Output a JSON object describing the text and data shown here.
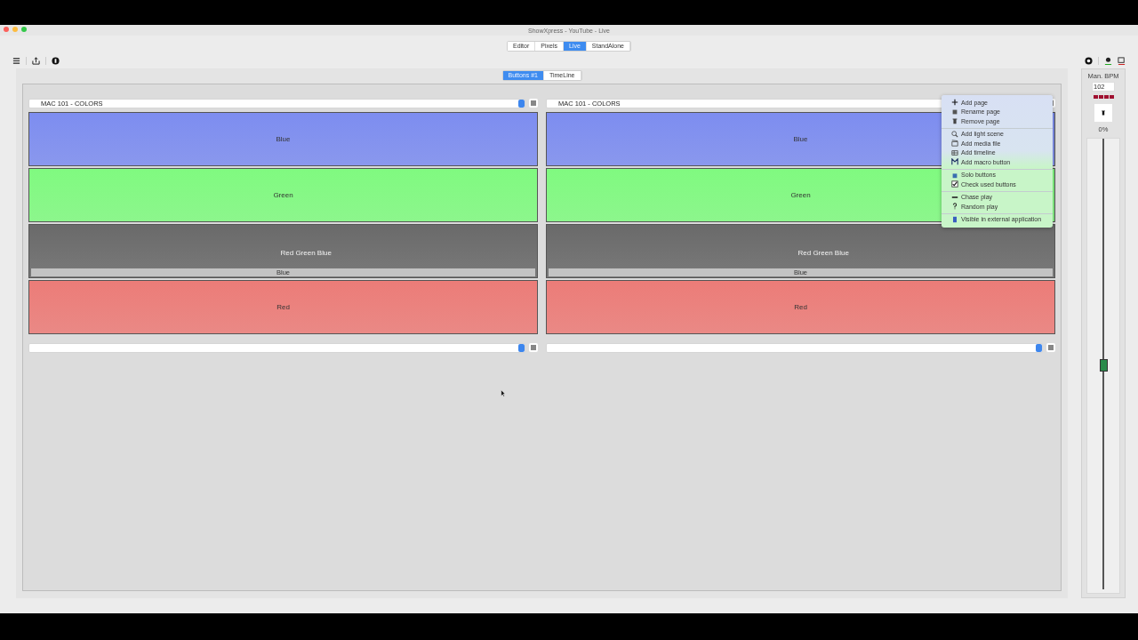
{
  "window": {
    "title": "ShowXpress - YouTube - Live"
  },
  "mode_tabs": [
    {
      "label": "Editor",
      "selected": false
    },
    {
      "label": "Pixels",
      "selected": false
    },
    {
      "label": "Live",
      "selected": true
    },
    {
      "label": "StandAlone",
      "selected": false
    }
  ],
  "view_tabs": [
    {
      "label": "Buttons #1",
      "selected": true
    },
    {
      "label": "TimeLine",
      "selected": false
    }
  ],
  "columns": [
    {
      "page": "MAC 101 - COLORS",
      "buttons": [
        {
          "label": "Blue",
          "color": "#7d8df0"
        },
        {
          "label": "Green",
          "color": "#80fa80"
        },
        {
          "label": "Red Green Blue",
          "color": "#6a6a6a",
          "sub_label": "Blue"
        },
        {
          "label": "Red",
          "color": "#ec7c78"
        }
      ]
    },
    {
      "page": "MAC 101 - COLORS",
      "buttons": [
        {
          "label": "Blue",
          "color": "#7d8df0"
        },
        {
          "label": "Green",
          "color": "#80fa80"
        },
        {
          "label": "Red Green Blue",
          "color": "#6a6a6a",
          "sub_label": "Blue"
        },
        {
          "label": "Red",
          "color": "#ec7c78"
        }
      ]
    }
  ],
  "context_menu": {
    "sections": [
      {
        "items": [
          {
            "label": "Add page",
            "kind": "plus"
          },
          {
            "label": "Rename page",
            "kind": "rename"
          },
          {
            "label": "Remove page",
            "kind": "trash"
          }
        ]
      },
      {
        "items": [
          {
            "label": "Add light scene",
            "kind": "magnifier"
          },
          {
            "label": "Add media file",
            "kind": "clapper"
          },
          {
            "label": "Add timeline",
            "kind": "timeline"
          },
          {
            "label": "Add macro button",
            "kind": "macro"
          }
        ]
      },
      {
        "items": [
          {
            "label": "Solo buttons",
            "kind": "solo"
          },
          {
            "label": "Check used buttons",
            "kind": "check"
          }
        ]
      },
      {
        "items": [
          {
            "label": "Chase play",
            "kind": "dash"
          },
          {
            "label": "Random play",
            "kind": "question"
          }
        ]
      },
      {
        "items": [
          {
            "label": "Visible in external application",
            "kind": "phone"
          }
        ]
      }
    ]
  },
  "sidebar": {
    "bpm_label": "Man. BPM",
    "bpm_value": "102",
    "percent": "0%",
    "level": 0.5
  }
}
